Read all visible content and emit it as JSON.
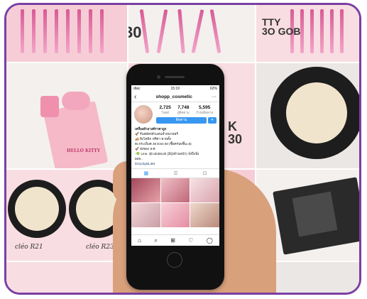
{
  "background": {
    "tile_texts": {
      "top_middle_number": "30",
      "top_right_line1": "TTY",
      "top_right_line2": "3O GOB",
      "mid_right_line1": "K",
      "mid_right_line2": "30",
      "compact_label_left": "cléo R21",
      "compact_label_right": "cléo R23",
      "pink_box_brand": "HELLO KITTY"
    },
    "accent_color": "#7a3fa3"
  },
  "phone": {
    "status_bar": {
      "carrier": "dtac",
      "time": "15:19",
      "battery": "62%"
    },
    "header": {
      "back_icon": "‹",
      "username": "shopp_cosmetic",
      "more_icon": "···"
    },
    "profile": {
      "posts_count": "2,725",
      "posts_label": "โพสต์",
      "followers_count": "7,748",
      "followers_label": "ผู้ติดตาม",
      "following_count": "5,595",
      "following_label": "กำลังติดตาม",
      "follow_button": "ติดตาม",
      "dropdown_icon": "▾"
    },
    "bio": {
      "name": "เครื่องสำอางค์ราคาถูก",
      "line1": "🚀 รับสมัครตัวแทนจำหน่ายฟรี",
      "line2": "🚚 สิงโตพิก ฟรีค่า ขายทั้ง",
      "line3": "ตะกระเพ็บค 30 Ems 50 (ซื้อครบ5ชิ้น=5)",
      "line4": "🚀 ส่งของ จ-ศ",
      "line5": "-🍀 Line: @cxb3914b (มี@ด้านหน้า) จั่งปึ่งปั่ง",
      "line6": "ผลจ..",
      "link": "bit.ly/2gNL3M"
    },
    "tabs": [
      "grid-icon",
      "list-icon",
      "tagged-icon"
    ],
    "bottom_nav": [
      "home-icon",
      "search-icon",
      "add-icon",
      "heart-icon",
      "profile-icon"
    ]
  }
}
